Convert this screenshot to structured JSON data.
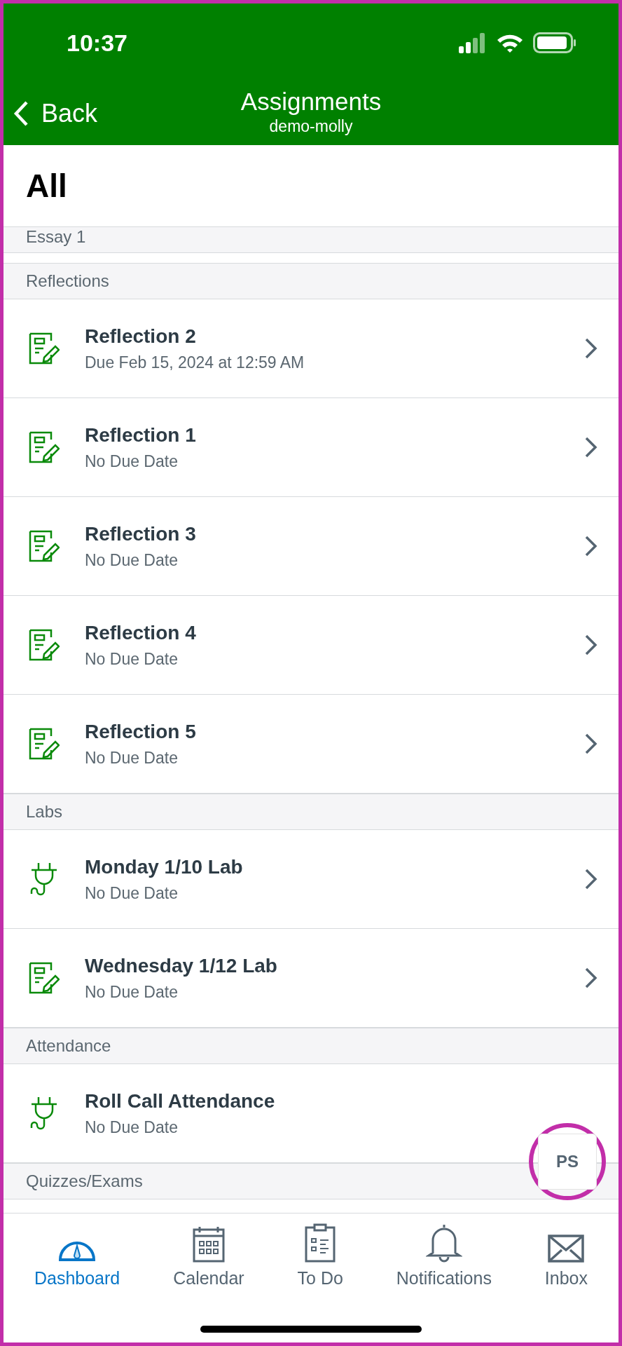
{
  "status_bar": {
    "time": "10:37"
  },
  "nav": {
    "back": "Back",
    "title": "Assignments",
    "subtitle": "demo-molly"
  },
  "filter_title": "All",
  "sections": [
    {
      "title": "Essay 1"
    },
    {
      "title": "Reflections",
      "items": [
        {
          "kind": "assignment",
          "title": "Reflection 2",
          "due": "Due Feb 15, 2024 at 12:59 AM"
        },
        {
          "kind": "assignment",
          "title": "Reflection 1",
          "due": "No Due Date"
        },
        {
          "kind": "assignment",
          "title": "Reflection 3",
          "due": "No Due Date"
        },
        {
          "kind": "assignment",
          "title": "Reflection 4",
          "due": "No Due Date"
        },
        {
          "kind": "assignment",
          "title": "Reflection 5",
          "due": "No Due Date"
        }
      ]
    },
    {
      "title": "Labs",
      "items": [
        {
          "kind": "external",
          "title": "Monday 1/10 Lab",
          "due": "No Due Date"
        },
        {
          "kind": "assignment",
          "title": "Wednesday 1/12 Lab",
          "due": "No Due Date"
        }
      ]
    },
    {
      "title": "Attendance",
      "items": [
        {
          "kind": "external",
          "title": "Roll Call Attendance",
          "due": "No Due Date"
        }
      ]
    },
    {
      "title": "Quizzes/Exams"
    }
  ],
  "avatar_button": {
    "initials": "PS"
  },
  "tabs": [
    {
      "kind": "dashboard",
      "label": "Dashboard",
      "selected": true
    },
    {
      "kind": "calendar",
      "label": "Calendar",
      "selected": false
    },
    {
      "kind": "todo",
      "label": "To Do",
      "selected": false
    },
    {
      "kind": "notifications",
      "label": "Notifications",
      "selected": false
    },
    {
      "kind": "inbox",
      "label": "Inbox",
      "selected": false
    }
  ]
}
